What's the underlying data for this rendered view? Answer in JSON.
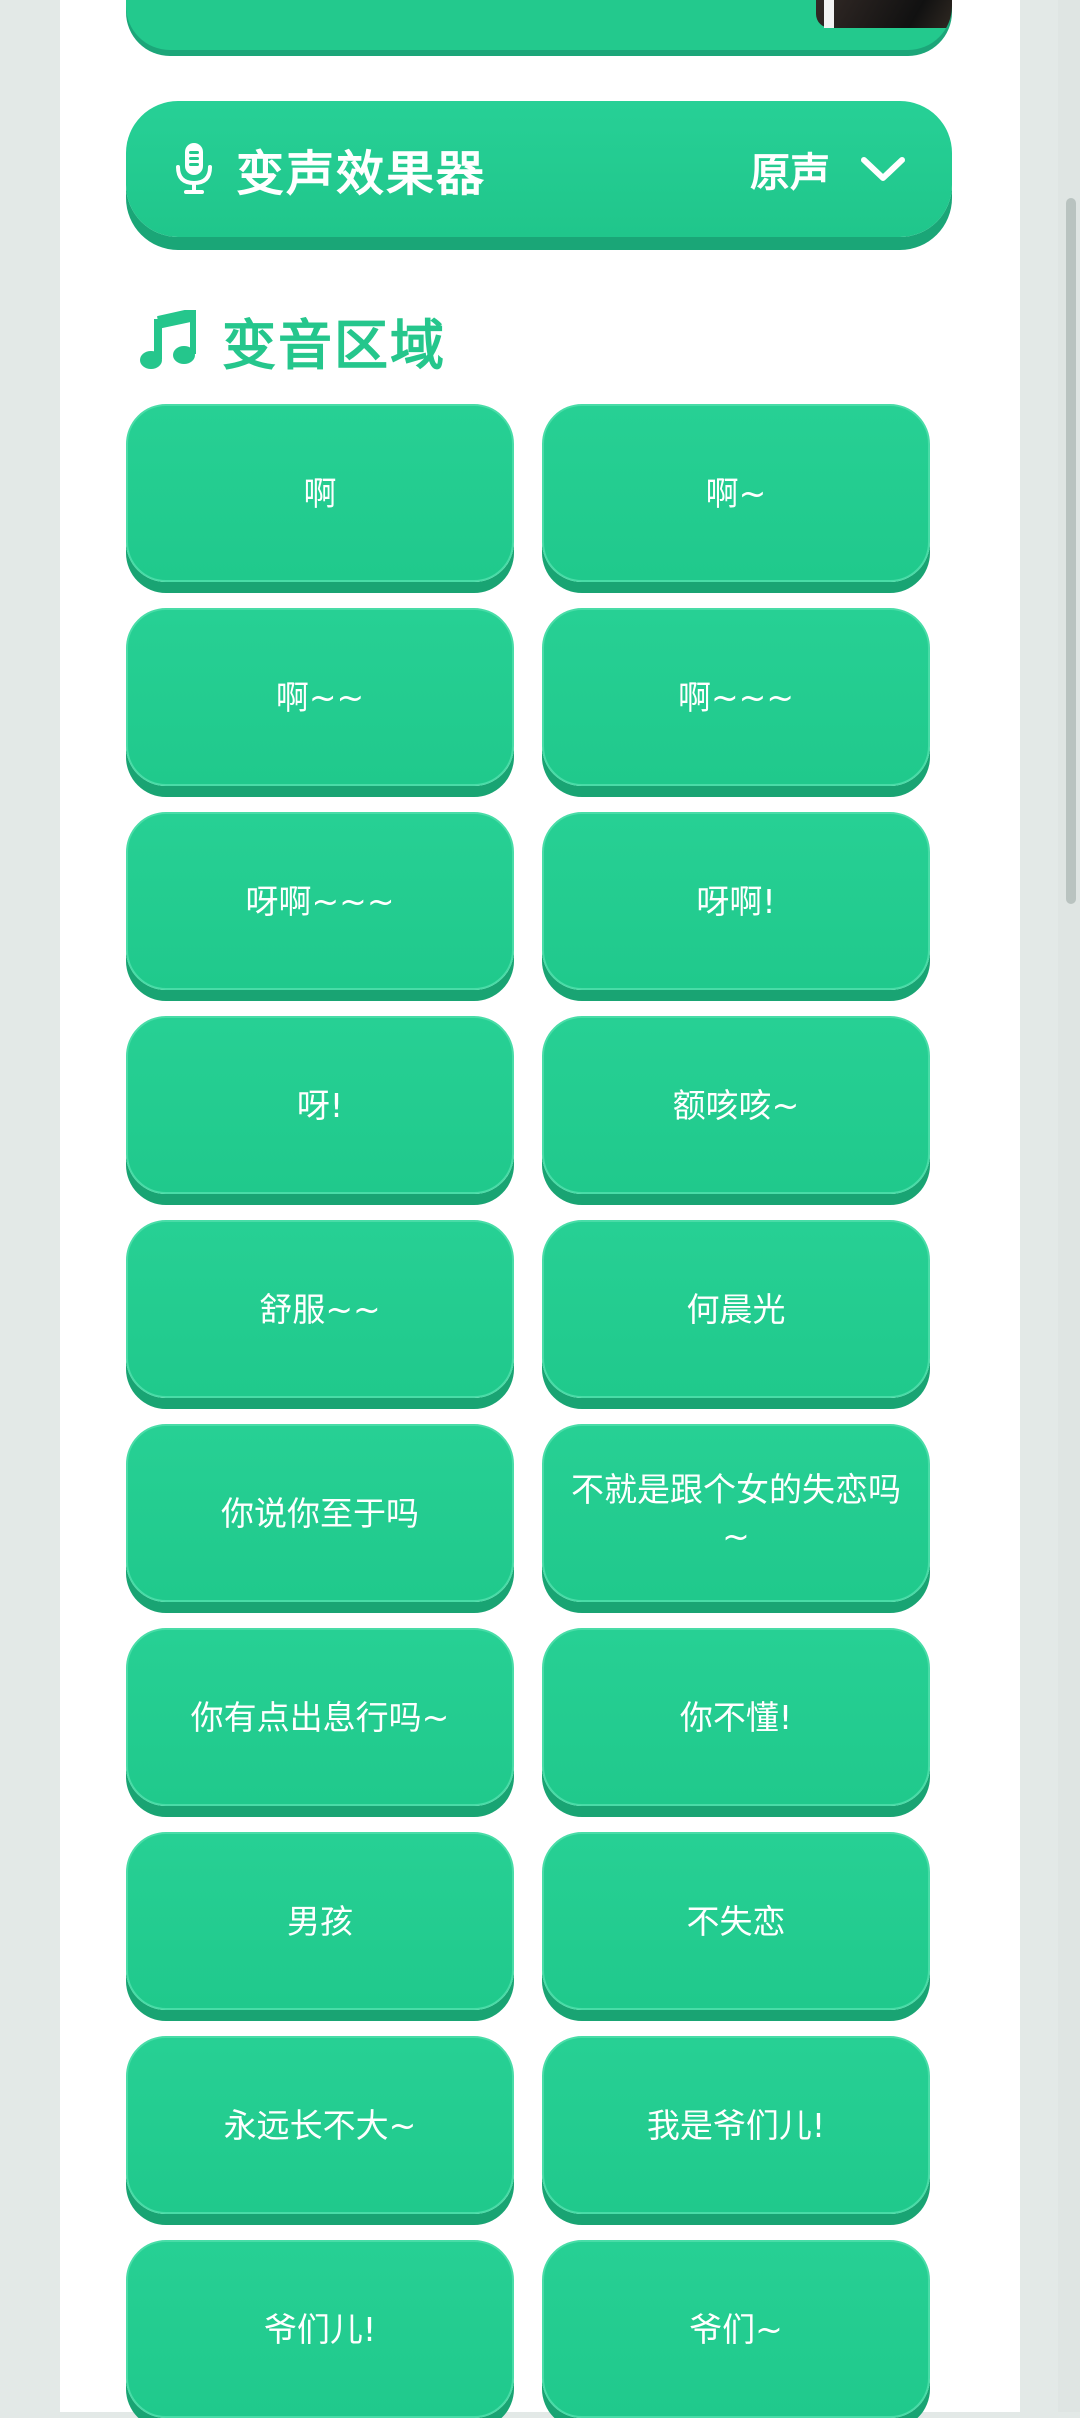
{
  "effects": {
    "title": "变声效果器",
    "value": "原声",
    "icon": "microphone-icon",
    "dropdown_icon": "chevron-down-icon"
  },
  "section": {
    "title": "变音区域",
    "icon": "music-note-icon"
  },
  "sounds": [
    "啊",
    "啊~",
    "啊~~",
    "啊~~~",
    "呀啊~~~",
    "呀啊!",
    "呀!",
    "额咳咳~",
    "舒服~~",
    "何晨光",
    "你说你至于吗",
    "不就是跟个女的失恋吗~",
    "你有点出息行吗~",
    "你不懂!",
    "男孩",
    "不失恋",
    "永远长不大~",
    "我是爷们儿!",
    "爷们儿!",
    "爷们~"
  ],
  "colors": {
    "accent": "#23c98d",
    "accent_shadow": "#1aa677",
    "background": "#e3e9e7"
  }
}
